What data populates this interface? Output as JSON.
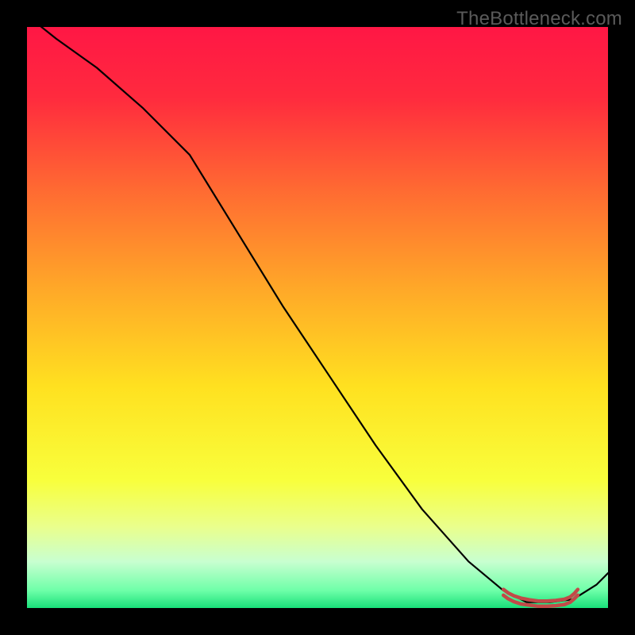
{
  "watermark": "TheBottleneck.com",
  "chart_data": {
    "type": "line",
    "title": "",
    "xlabel": "",
    "ylabel": "",
    "xlim": [
      0,
      100
    ],
    "ylim": [
      0,
      100
    ],
    "grid": false,
    "background_gradient": {
      "stops": [
        {
          "offset": 0.0,
          "color": "#ff1745"
        },
        {
          "offset": 0.12,
          "color": "#ff2a3e"
        },
        {
          "offset": 0.28,
          "color": "#ff6a32"
        },
        {
          "offset": 0.45,
          "color": "#ffa828"
        },
        {
          "offset": 0.62,
          "color": "#ffe120"
        },
        {
          "offset": 0.78,
          "color": "#f8ff3c"
        },
        {
          "offset": 0.86,
          "color": "#eaff8c"
        },
        {
          "offset": 0.92,
          "color": "#c8ffd0"
        },
        {
          "offset": 0.97,
          "color": "#6effa8"
        },
        {
          "offset": 1.0,
          "color": "#18e07a"
        }
      ]
    },
    "series": [
      {
        "name": "black-curve",
        "color": "#000000",
        "width": 2.2,
        "x": [
          0,
          5,
          12,
          20,
          28,
          36,
          44,
          52,
          60,
          68,
          76,
          82,
          86,
          90,
          94,
          98,
          100
        ],
        "y": [
          102,
          98,
          93,
          86,
          78,
          65,
          52,
          40,
          28,
          17,
          8,
          3,
          1,
          1,
          1.5,
          4,
          6
        ]
      },
      {
        "name": "red-band-top",
        "color": "#c24a48",
        "width": 4.5,
        "x": [
          82.0,
          82.8,
          83.8,
          85.0,
          86.5,
          88.0,
          89.5,
          91.0,
          92.5,
          93.5,
          94.2,
          94.8
        ],
        "y": [
          3.2,
          2.6,
          2.1,
          1.7,
          1.4,
          1.2,
          1.2,
          1.3,
          1.5,
          1.9,
          2.5,
          3.2
        ]
      },
      {
        "name": "red-band-bottom",
        "color": "#c24a48",
        "width": 4.5,
        "x": [
          82.0,
          82.8,
          83.8,
          85.0,
          86.5,
          88.0,
          89.5,
          91.0,
          92.5,
          93.5,
          94.2,
          94.8
        ],
        "y": [
          2.2,
          1.6,
          1.1,
          0.7,
          0.5,
          0.3,
          0.3,
          0.4,
          0.6,
          1.0,
          1.6,
          2.2
        ]
      }
    ]
  }
}
